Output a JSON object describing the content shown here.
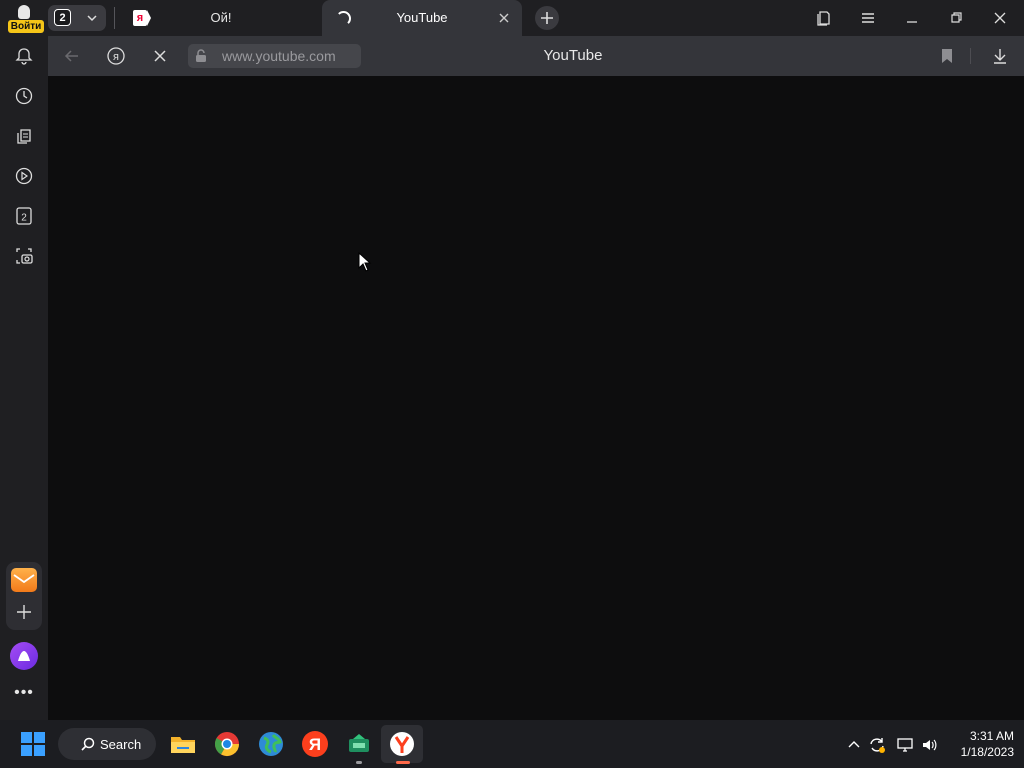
{
  "profile": {
    "login_label": "Войти"
  },
  "tab_group": {
    "count": "2"
  },
  "tabs": [
    {
      "title": "Ой!",
      "favicon": "yandex-page-icon"
    },
    {
      "title": "YouTube",
      "state": "loading"
    }
  ],
  "toolbar": {
    "url": "www.youtube.com",
    "page_title": "YouTube"
  },
  "sidebar": {
    "more_label": "•••"
  },
  "taskbar": {
    "search_label": "Search",
    "apps": [
      "windows-start",
      "file-explorer",
      "chrome",
      "globe-app",
      "yandex",
      "green-app",
      "yandex-browser"
    ]
  },
  "clock": {
    "time": "3:31 AM",
    "date": "1/18/2023"
  },
  "colors": {
    "accent_login": "#f5c518",
    "yandex_red": "#fc3f1d",
    "alice_purple": "#8b3ff0"
  }
}
